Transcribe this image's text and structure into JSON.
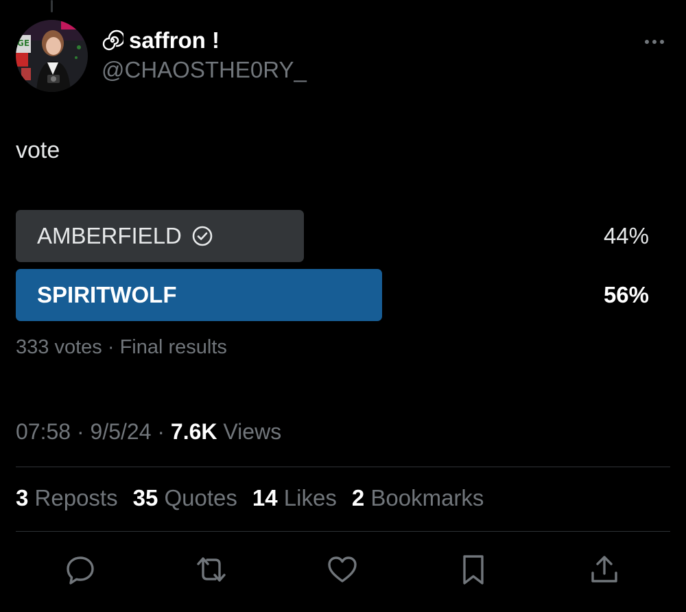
{
  "tweet": {
    "display_name": "saffron !",
    "handle": "@CHAOSTHE0RY_",
    "text": "vote"
  },
  "icons": {
    "name_emoji": "cyclone-icon",
    "more": "ellipsis-icon",
    "winner": "check-circle-icon"
  },
  "poll": {
    "options": [
      {
        "label": "AMBERFIELD",
        "percent": "44%",
        "value": 0.44,
        "checked": true,
        "winner": false
      },
      {
        "label": "SPIRITWOLF",
        "percent": "56%",
        "value": 0.56,
        "checked": false,
        "winner": true
      }
    ],
    "votes": "333 votes",
    "separator": "·",
    "status": "Final results"
  },
  "meta": {
    "time": "07:58",
    "date": "9/5/24",
    "separator": "·",
    "views_count": "7.6K",
    "views_label": "Views"
  },
  "stats": [
    {
      "count": "3",
      "label": "Reposts"
    },
    {
      "count": "35",
      "label": "Quotes"
    },
    {
      "count": "14",
      "label": "Likes"
    },
    {
      "count": "2",
      "label": "Bookmarks"
    }
  ],
  "actions": [
    {
      "name": "reply",
      "icon": "reply-icon"
    },
    {
      "name": "repost",
      "icon": "repost-icon"
    },
    {
      "name": "like",
      "icon": "heart-icon"
    },
    {
      "name": "bookmark",
      "icon": "bookmark-icon"
    },
    {
      "name": "share",
      "icon": "share-icon"
    }
  ],
  "colors": {
    "background": "#000000",
    "text_primary": "#e7e9ea",
    "text_secondary": "#71767b",
    "poll_bar_default": "#333639",
    "poll_bar_winner": "#175d95",
    "divider": "#2f3336"
  }
}
